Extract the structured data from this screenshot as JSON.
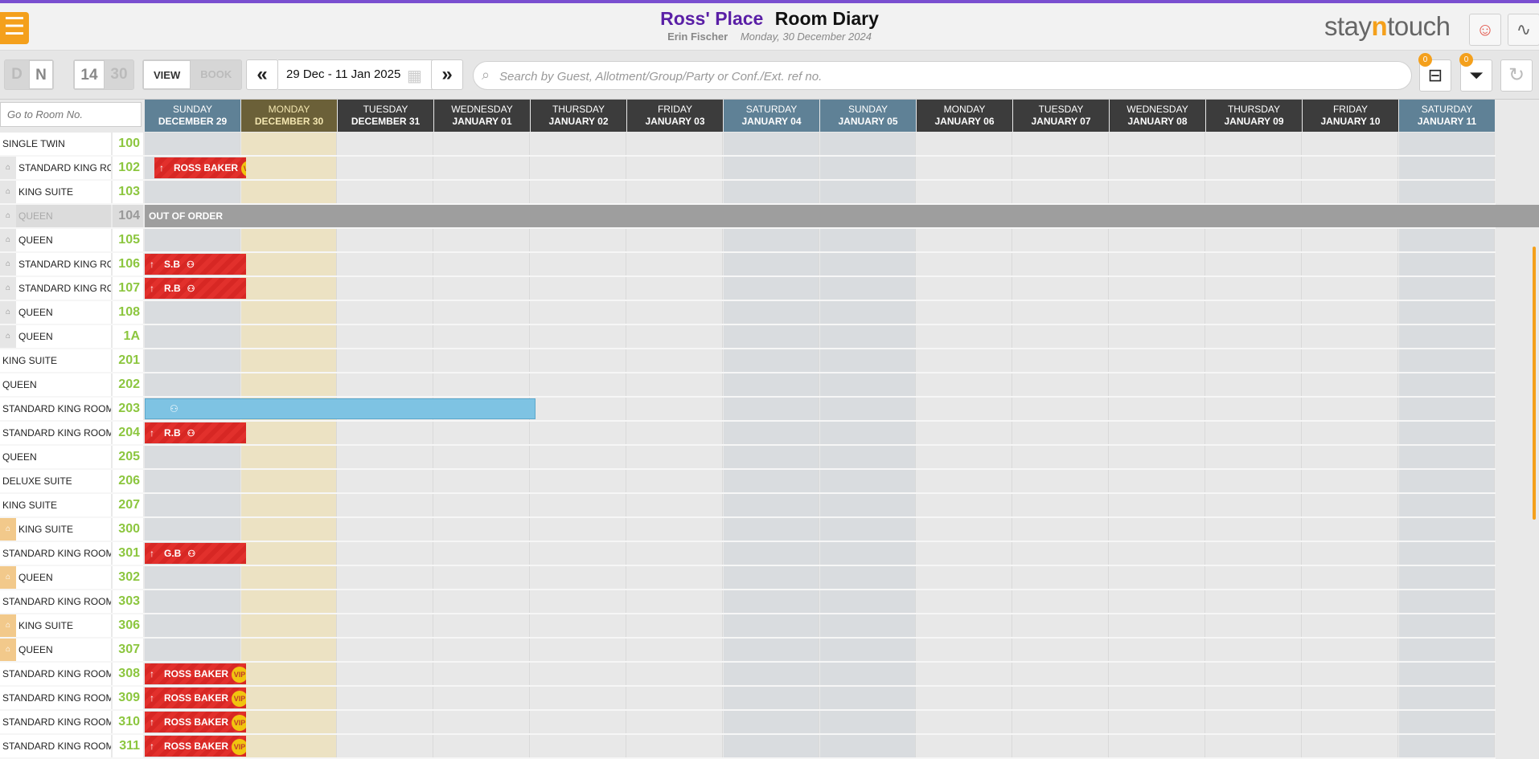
{
  "header": {
    "hotel_name": "Ross' Place",
    "page_title": "Room Diary",
    "user": "Erin Fischer",
    "date": "Monday, 30 December 2024",
    "brand_pre": "stay",
    "brand_n": "n",
    "brand_post": "touch"
  },
  "toolbar": {
    "day_d": "D",
    "day_n": "N",
    "range_14": "14",
    "range_30": "30",
    "view_label": "VIEW",
    "book_label": "BOOK",
    "date_range": "29 Dec - 11 Jan 2025",
    "search_placeholder": "Search by Guest, Allotment/Group/Party or Conf./Ext. ref no.",
    "badge_unassigned": "0",
    "badge_filter": "0"
  },
  "diary": {
    "goto_placeholder": "Go to Room No.",
    "days": [
      {
        "dow": "SUNDAY",
        "date": "DECEMBER 29",
        "kind": "wk"
      },
      {
        "dow": "MONDAY",
        "date": "DECEMBER 30",
        "kind": "today"
      },
      {
        "dow": "TUESDAY",
        "date": "DECEMBER 31",
        "kind": "norm"
      },
      {
        "dow": "WEDNESDAY",
        "date": "JANUARY 01",
        "kind": "norm"
      },
      {
        "dow": "THURSDAY",
        "date": "JANUARY 02",
        "kind": "norm"
      },
      {
        "dow": "FRIDAY",
        "date": "JANUARY 03",
        "kind": "norm"
      },
      {
        "dow": "SATURDAY",
        "date": "JANUARY 04",
        "kind": "wk"
      },
      {
        "dow": "SUNDAY",
        "date": "JANUARY 05",
        "kind": "wk"
      },
      {
        "dow": "MONDAY",
        "date": "JANUARY 06",
        "kind": "norm"
      },
      {
        "dow": "TUESDAY",
        "date": "JANUARY 07",
        "kind": "norm"
      },
      {
        "dow": "WEDNESDAY",
        "date": "JANUARY 08",
        "kind": "norm"
      },
      {
        "dow": "THURSDAY",
        "date": "JANUARY 09",
        "kind": "norm"
      },
      {
        "dow": "FRIDAY",
        "date": "JANUARY 10",
        "kind": "norm"
      },
      {
        "dow": "SATURDAY",
        "date": "JANUARY 11",
        "kind": "wk"
      }
    ],
    "out_of_order_label": "OUT OF ORDER",
    "vip_label": "VIP",
    "rooms": [
      {
        "type": "SINGLE TWIN",
        "num": "100",
        "icon": "none"
      },
      {
        "type": "STANDARD KING ROOM",
        "num": "102",
        "icon": "grey",
        "res": {
          "label": "ROSS BAKER",
          "vip": true,
          "start": 0.1,
          "days": 0.95
        }
      },
      {
        "type": "KING SUITE",
        "num": "103",
        "icon": "grey"
      },
      {
        "type": "QUEEN",
        "num": "104",
        "icon": "grey",
        "ooo": true,
        "muted": true
      },
      {
        "type": "QUEEN",
        "num": "105",
        "icon": "grey"
      },
      {
        "type": "STANDARD KING ROOM",
        "num": "106",
        "icon": "grey",
        "res": {
          "label": "S.B",
          "group": true,
          "start": 0,
          "days": 1.05
        }
      },
      {
        "type": "STANDARD KING ROOM",
        "num": "107",
        "icon": "grey",
        "res": {
          "label": "R.B",
          "group": true,
          "start": 0,
          "days": 1.05
        }
      },
      {
        "type": "QUEEN",
        "num": "108",
        "icon": "grey"
      },
      {
        "type": "QUEEN",
        "num": "1A",
        "icon": "grey"
      },
      {
        "type": "KING SUITE",
        "num": "201",
        "icon": "none"
      },
      {
        "type": "QUEEN",
        "num": "202",
        "icon": "none"
      },
      {
        "type": "STANDARD KING ROOM",
        "num": "203",
        "icon": "none",
        "blue": {
          "start": 0,
          "days": 4.05
        }
      },
      {
        "type": "STANDARD KING ROOM",
        "num": "204",
        "icon": "none",
        "res": {
          "label": "R.B",
          "group": true,
          "start": 0,
          "days": 1.05
        }
      },
      {
        "type": "QUEEN",
        "num": "205",
        "icon": "none"
      },
      {
        "type": "DELUXE SUITE",
        "num": "206",
        "icon": "none"
      },
      {
        "type": "KING SUITE",
        "num": "207",
        "icon": "none"
      },
      {
        "type": "KING SUITE",
        "num": "300",
        "icon": "orange"
      },
      {
        "type": "STANDARD KING ROOM",
        "num": "301",
        "icon": "none",
        "res": {
          "label": "G.B",
          "group": true,
          "start": 0,
          "days": 1.05
        }
      },
      {
        "type": "QUEEN",
        "num": "302",
        "icon": "orange"
      },
      {
        "type": "STANDARD KING ROOM",
        "num": "303",
        "icon": "none"
      },
      {
        "type": "KING SUITE",
        "num": "306",
        "icon": "orange"
      },
      {
        "type": "QUEEN",
        "num": "307",
        "icon": "orange"
      },
      {
        "type": "STANDARD KING ROOM",
        "num": "308",
        "icon": "none",
        "res": {
          "label": "ROSS BAKER",
          "vip": true,
          "start": 0,
          "days": 1.05
        }
      },
      {
        "type": "STANDARD KING ROOM",
        "num": "309",
        "icon": "none",
        "res": {
          "label": "ROSS BAKER",
          "vip": true,
          "start": 0,
          "days": 1.05
        }
      },
      {
        "type": "STANDARD KING ROOM",
        "num": "310",
        "icon": "none",
        "res": {
          "label": "ROSS BAKER",
          "vip": true,
          "start": 0,
          "days": 1.05
        }
      },
      {
        "type": "STANDARD KING ROOM",
        "num": "311",
        "icon": "none",
        "res": {
          "label": "ROSS BAKER",
          "vip": true,
          "start": 0,
          "days": 1.05
        }
      }
    ]
  },
  "colors": {
    "accent": "#7a4fd0",
    "brand_orange": "#f4a01c",
    "reservation_red": "#e2302c",
    "weekend_header": "#5f8196",
    "today_header": "#6b6038",
    "weekday_header": "#3c3c3c",
    "room_number": "#8cc63f"
  },
  "icons": {
    "menu": "hamburger-icon",
    "chat": "chat-icon",
    "activity": "activity-icon",
    "prev": "double-chevron-left-icon",
    "next": "double-chevron-right-icon",
    "grid": "grid-icon",
    "search": "search-icon",
    "unassigned": "bed-icon",
    "filter": "filter-icon",
    "refresh": "refresh-icon",
    "housekeeping": "bed-status-icon"
  }
}
